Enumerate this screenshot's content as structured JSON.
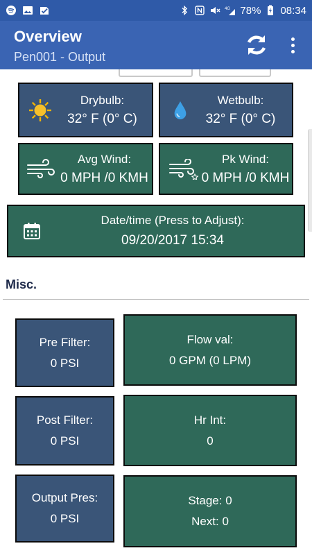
{
  "status_bar": {
    "battery": "78%",
    "time": "08:34",
    "network": "4G"
  },
  "app_bar": {
    "title": "Overview",
    "subtitle": "Pen001 - Output"
  },
  "weather": {
    "drybulb": {
      "label": "Drybulb:",
      "value": "32° F (0° C)"
    },
    "wetbulb": {
      "label": "Wetbulb:",
      "value": "32° F (0° C)"
    },
    "avg_wind": {
      "label": "Avg Wind:",
      "value": "0 MPH /0 KMH"
    },
    "pk_wind": {
      "label": "Pk Wind:",
      "value": "0 MPH /0 KMH"
    },
    "datetime": {
      "label": "Date/time (Press to Adjust):",
      "value": "09/20/2017 15:34"
    }
  },
  "misc": {
    "heading": "Misc.",
    "pre_filter": {
      "label": "Pre Filter:",
      "value": "0 PSI"
    },
    "flow_val": {
      "label": "Flow val:",
      "value": "0 GPM (0 LPM)"
    },
    "post_filter": {
      "label": "Post Filter:",
      "value": "0 PSI"
    },
    "hr_int": {
      "label": "Hr Int:",
      "value": "0"
    },
    "output_pres": {
      "label": "Output Pres:",
      "value": "0 PSI"
    },
    "stage": {
      "label": "Stage: 0",
      "value": "Next: 0"
    }
  },
  "colors": {
    "app_bar": "#3a64b3",
    "status_bar": "#2f5aa8",
    "tile_blue": "#3a5578",
    "tile_green": "#2f6959"
  }
}
